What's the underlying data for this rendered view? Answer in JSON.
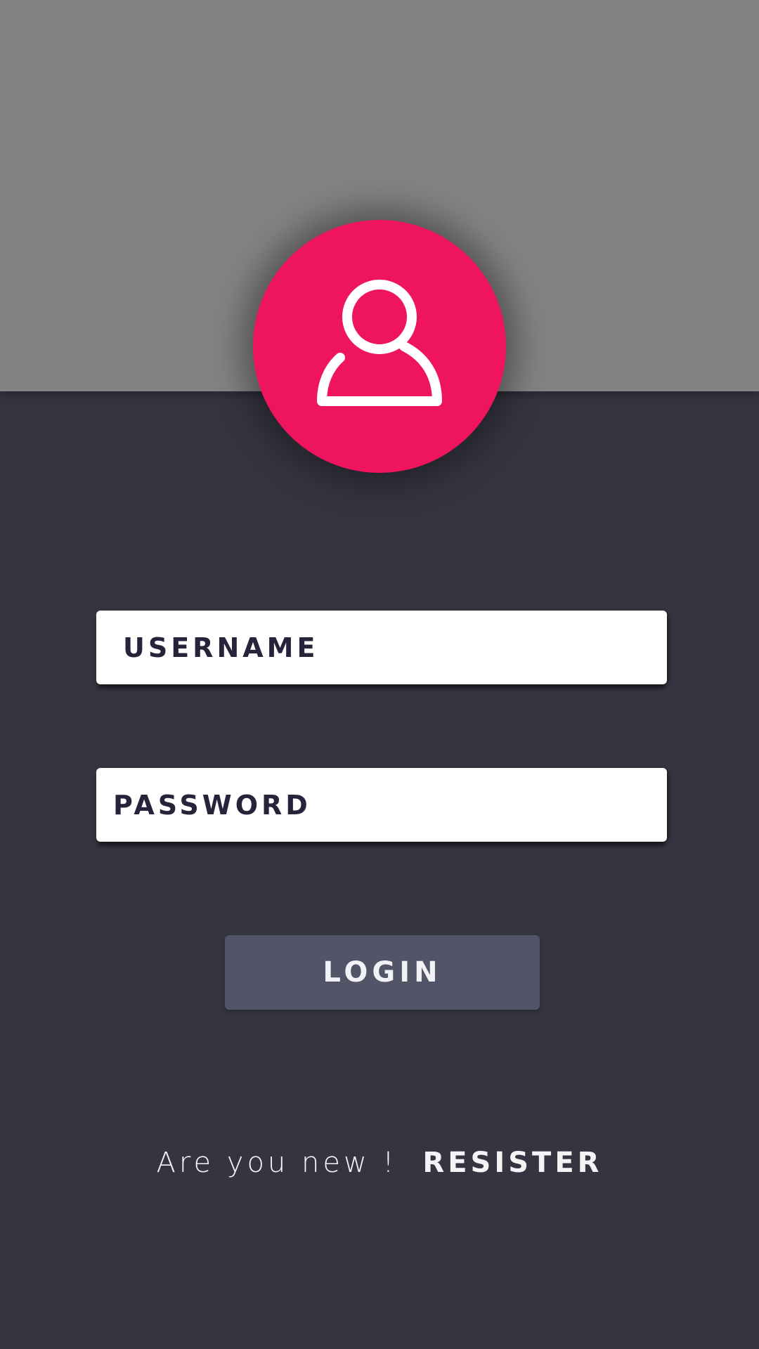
{
  "colors": {
    "background": "#353541",
    "top_band": "#838383",
    "accent": "#ef145e",
    "field_background": "#ffffff",
    "field_text": "#25243a",
    "button_background": "#525467",
    "text_light": "#f4f4f7"
  },
  "avatar": {
    "icon": "user-icon"
  },
  "form": {
    "username": {
      "value": "",
      "placeholder": "USERNAME"
    },
    "password": {
      "value": "",
      "placeholder": "PASSWORD"
    },
    "login_label": "LOGIN"
  },
  "footer": {
    "prompt": "Are you new !",
    "register_label": "RESISTER"
  }
}
